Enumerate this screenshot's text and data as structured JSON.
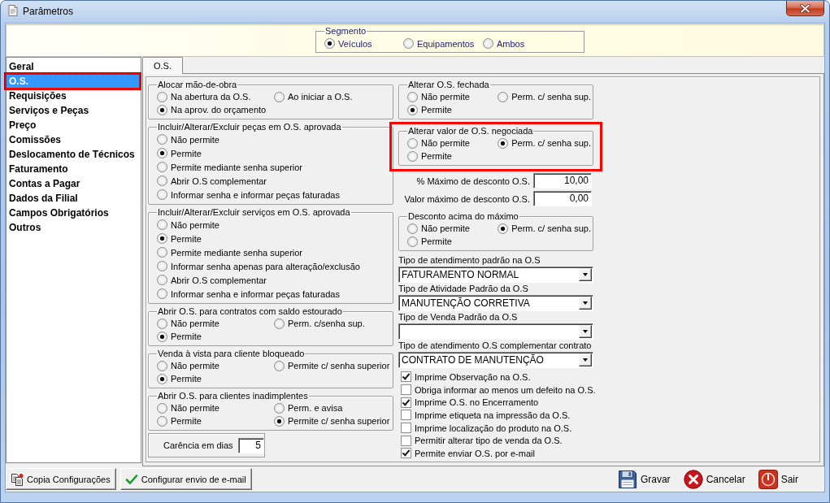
{
  "window": {
    "title": "Parâmetros"
  },
  "segment": {
    "title": "Segmento",
    "options": [
      {
        "label": "Veículos",
        "selected": true
      },
      {
        "label": "Equipamentos",
        "selected": false
      },
      {
        "label": "Ambos",
        "selected": false
      }
    ]
  },
  "sidebar": {
    "items": [
      {
        "label": "Geral",
        "selected": false,
        "highlighted": false
      },
      {
        "label": "O.S.",
        "selected": true,
        "highlighted": true
      },
      {
        "label": "Requisições",
        "selected": false,
        "highlighted": false
      },
      {
        "label": "Serviços e Peças",
        "selected": false,
        "highlighted": false
      },
      {
        "label": "Preço",
        "selected": false,
        "highlighted": false
      },
      {
        "label": "Comissões",
        "selected": false,
        "highlighted": false
      },
      {
        "label": "Deslocamento de Técnicos",
        "selected": false,
        "highlighted": false
      },
      {
        "label": "Faturamento",
        "selected": false,
        "highlighted": false
      },
      {
        "label": "Contas a Pagar",
        "selected": false,
        "highlighted": false
      },
      {
        "label": "Dados da Filial",
        "selected": false,
        "highlighted": false
      },
      {
        "label": "Campos Obrigatórios",
        "selected": false,
        "highlighted": false
      },
      {
        "label": "Outros",
        "selected": false,
        "highlighted": false
      }
    ]
  },
  "tabs": [
    {
      "label": "O.S.",
      "selected": true
    }
  ],
  "left_column": {
    "groups": [
      {
        "title": "Alocar mão-de-obra",
        "highlighted": false,
        "options": [
          {
            "label": "Na abertura da O.S.",
            "selected": false
          },
          {
            "label": "Ao iniciar a O.S.",
            "selected": false
          },
          {
            "label": "Na aprov. do orçamento",
            "selected": true
          }
        ]
      },
      {
        "title": "Incluir/Alterar/Excluir peças em O.S. aprovada",
        "highlighted": false,
        "options": [
          {
            "label": "Não permite",
            "selected": false
          },
          {
            "label": "Permite",
            "selected": true
          },
          {
            "label": "Permite mediante senha superior",
            "selected": false
          },
          {
            "label": "Abrir O.S complementar",
            "selected": false
          },
          {
            "label": "Informar senha e informar peças faturadas",
            "selected": false
          }
        ]
      },
      {
        "title": "Incluir/Alterar/Excluir serviços em O.S. aprovada",
        "highlighted": false,
        "options": [
          {
            "label": "Não permite",
            "selected": false
          },
          {
            "label": "Permite",
            "selected": true
          },
          {
            "label": "Permite mediante senha superior",
            "selected": false
          },
          {
            "label": "Informar senha apenas para alteração/exclusão",
            "selected": false
          },
          {
            "label": "Abrir O.S complementar",
            "selected": false
          },
          {
            "label": "Informar senha e informar peças faturadas",
            "selected": false
          }
        ]
      },
      {
        "title": "Abrir O.S. para contratos com saldo estourado",
        "highlighted": false,
        "options": [
          {
            "label": "Não permite",
            "selected": false
          },
          {
            "label": "Perm. c/senha sup.",
            "selected": false
          },
          {
            "label": "Permite",
            "selected": true
          }
        ]
      },
      {
        "title": "Venda à vista para cliente bloqueado",
        "highlighted": false,
        "options": [
          {
            "label": "Não permite",
            "selected": false
          },
          {
            "label": "Permite c/ senha superior",
            "selected": false
          },
          {
            "label": "Permite",
            "selected": true
          }
        ]
      },
      {
        "title": "Abrir O.S. para clientes inadimplentes",
        "highlighted": false,
        "options": [
          {
            "label": "Não permite",
            "selected": false
          },
          {
            "label": "Perm. e avisa",
            "selected": false
          },
          {
            "label": "Permite",
            "selected": false
          },
          {
            "label": "Permite c/ senha superior",
            "selected": true
          }
        ]
      }
    ],
    "grace_period": {
      "label": "Carência em dias",
      "value": "5"
    }
  },
  "right_column": {
    "items": [
      {
        "kind": "radio_group",
        "title": "Alterar O.S. fechada",
        "highlighted": false,
        "options": [
          {
            "label": "Não permite",
            "selected": false
          },
          {
            "label": "Perm. c/ senha sup.",
            "selected": false
          },
          {
            "label": "Permite",
            "selected": true
          }
        ]
      },
      {
        "kind": "radio_group",
        "title": "Alterar valor de O.S. negociada",
        "highlighted": true,
        "options": [
          {
            "label": "Não permite",
            "selected": false
          },
          {
            "label": "Perm. c/ senha sup.",
            "selected": true
          },
          {
            "label": "Permite",
            "selected": false
          }
        ]
      },
      {
        "kind": "number_field",
        "label": "% Máximo de desconto O.S.",
        "value": "10,00"
      },
      {
        "kind": "number_field",
        "label": "Valor máximo de desconto O.S.",
        "value": "0,00"
      },
      {
        "kind": "radio_group",
        "title": "Desconto acima do máximo",
        "highlighted": false,
        "options": [
          {
            "label": "Não permite",
            "selected": false
          },
          {
            "label": "Perm. c/ senha sup.",
            "selected": true
          },
          {
            "label": "Permite",
            "selected": false
          }
        ]
      },
      {
        "kind": "dropdown",
        "label": "Tipo de atendimento padrão na O.S",
        "value": "FATURAMENTO NORMAL"
      },
      {
        "kind": "dropdown",
        "label": "Tipo de Atividade Padrão da O.S",
        "value": "MANUTENÇÃO CORRETIVA"
      },
      {
        "kind": "dropdown",
        "label": "Tipo de Venda Padrão da O.S"
      },
      {
        "kind": "dropdown",
        "label": "Tipo de atendimento O.S complementar contrato",
        "value": "CONTRATO DE MANUTENÇÃO"
      },
      {
        "kind": "checkbox",
        "label": "Imprime Observação na O.S.",
        "checked": true
      },
      {
        "kind": "checkbox",
        "label": "Obriga informar ao menos um defeito na O.S.",
        "checked": false
      },
      {
        "kind": "checkbox",
        "label": "Imprime O.S. no Encerramento",
        "checked": true
      },
      {
        "kind": "checkbox",
        "label": "Imprime etiqueta na impressão da O.S.",
        "checked": false
      },
      {
        "kind": "checkbox",
        "label": "Imprime localização do produto na O.S.",
        "checked": false
      },
      {
        "kind": "checkbox",
        "label": "Permitir alterar tipo de venda da O.S.",
        "checked": false
      },
      {
        "kind": "checkbox",
        "label": "Permite enviar O.S. por e-mail",
        "checked": true
      }
    ]
  },
  "footer": {
    "left_buttons": [
      "Copia Configurações",
      "Configurar envio de e-mail"
    ],
    "right_buttons": [
      "Gravar",
      "Cancelar",
      "Sair"
    ]
  }
}
